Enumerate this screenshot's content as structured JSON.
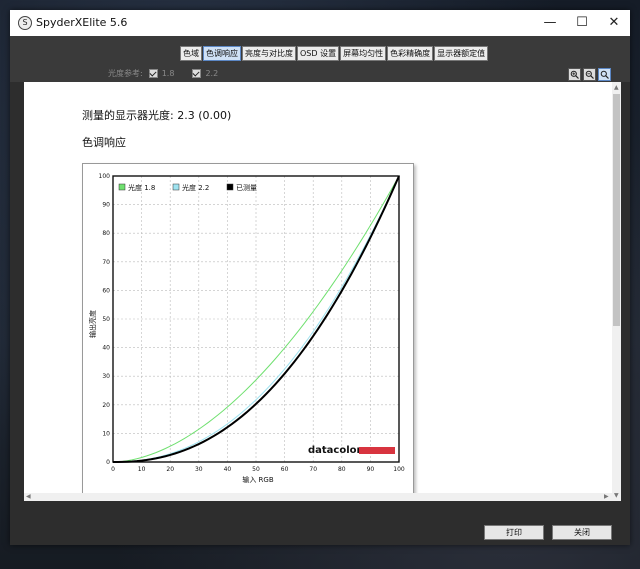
{
  "window": {
    "title": "SpyderXElite 5.6",
    "icon_glyph": "S",
    "controls": {
      "minimize": "—",
      "maximize": "☐",
      "close": "✕"
    }
  },
  "tabs": [
    {
      "label": "色域",
      "active": false
    },
    {
      "label": "色调响应",
      "active": true
    },
    {
      "label": "亮度与对比度",
      "active": false
    },
    {
      "label": "OSD 设置",
      "active": false
    },
    {
      "label": "屏幕均匀性",
      "active": false
    },
    {
      "label": "色彩精确度",
      "active": false
    },
    {
      "label": "显示器额定值",
      "active": false
    }
  ],
  "gamma_reference": {
    "label": "光度参考:",
    "options": [
      {
        "label": "1.8",
        "checked": true
      },
      {
        "label": "2.2",
        "checked": true
      }
    ]
  },
  "zoom_icons": [
    "zoom-in-icon",
    "zoom-out-icon",
    "zoom-fit-icon"
  ],
  "content": {
    "measured_label": "测量的显示器光度:",
    "measured_value": "2.3 (0.00)",
    "section_title": "色调响应"
  },
  "chart_data": {
    "type": "line",
    "xlabel": "输入 RGB",
    "ylabel": "输出亮度",
    "xlim": [
      0,
      100
    ],
    "ylim": [
      0,
      100
    ],
    "x_ticks": [
      0,
      10,
      20,
      30,
      40,
      50,
      60,
      70,
      80,
      90,
      100
    ],
    "y_ticks": [
      0,
      10,
      20,
      30,
      40,
      50,
      60,
      70,
      80,
      90,
      100
    ],
    "grid": true,
    "legend_position": "top-left",
    "series": [
      {
        "name": "光度 1.8",
        "color": "#6fe06f",
        "gamma": 1.8,
        "x": [
          0,
          10,
          20,
          30,
          40,
          50,
          60,
          70,
          80,
          90,
          100
        ],
        "y": [
          0,
          1.6,
          5.5,
          11.5,
          19.2,
          28.7,
          39.9,
          52.6,
          66.9,
          82.7,
          100
        ]
      },
      {
        "name": "光度 2.2",
        "color": "#9fe3f0",
        "gamma": 2.2,
        "x": [
          0,
          10,
          20,
          30,
          40,
          50,
          60,
          70,
          80,
          90,
          100
        ],
        "y": [
          0,
          0.6,
          2.9,
          7.1,
          13.3,
          21.8,
          32.5,
          45.6,
          61.2,
          79.3,
          100
        ]
      },
      {
        "name": "已测量",
        "color": "#000000",
        "gamma": 2.3,
        "x": [
          0,
          10,
          20,
          30,
          40,
          50,
          60,
          70,
          80,
          90,
          100
        ],
        "y": [
          0,
          0.5,
          2.5,
          6.3,
          12.2,
          20.3,
          30.9,
          44.0,
          59.8,
          78.5,
          100
        ]
      }
    ],
    "brand": "datacolor",
    "brand_bar_color": "#d8343f"
  },
  "buttons": {
    "print": "打印",
    "close": "关闭"
  }
}
